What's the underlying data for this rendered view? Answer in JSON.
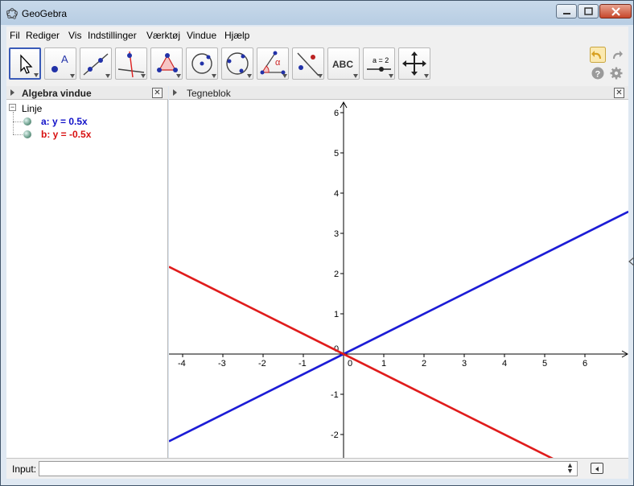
{
  "window": {
    "title": "GeoGebra"
  },
  "menu": [
    "Fil",
    "Rediger",
    "Vis",
    "Indstillinger",
    "Værktøj",
    "Vindue",
    "Hjælp"
  ],
  "toolbar": {
    "tools": [
      {
        "name": "move-tool",
        "icon": "arrow-pointer-icon",
        "active": true
      },
      {
        "name": "point-tool",
        "icon": "point-icon",
        "label": "A"
      },
      {
        "name": "line-tool",
        "icon": "line-through-points-icon"
      },
      {
        "name": "perpendicular-line-tool",
        "icon": "perpendicular-line-icon"
      },
      {
        "name": "polygon-tool",
        "icon": "polygon-icon"
      },
      {
        "name": "circle-tool",
        "icon": "circle-center-point-icon"
      },
      {
        "name": "conic-tool",
        "icon": "ellipse-icon"
      },
      {
        "name": "angle-tool",
        "icon": "angle-icon",
        "label": "α"
      },
      {
        "name": "reflect-tool",
        "icon": "reflect-about-line-icon"
      },
      {
        "name": "text-tool",
        "icon": "text-icon",
        "label": "ABC"
      },
      {
        "name": "slider-tool",
        "icon": "slider-icon",
        "label": "a = 2"
      },
      {
        "name": "move-graphics-tool",
        "icon": "move-graphics-icon"
      }
    ],
    "undo_icon": "undo-icon",
    "redo_icon": "redo-icon",
    "help_icon": "help-icon",
    "settings_icon": "gear-icon"
  },
  "algebra": {
    "title": "Algebra vindue",
    "group": "Linje",
    "items": [
      {
        "text": "a: y = 0.5x",
        "color": "#1010c8"
      },
      {
        "text": "b: y = -0.5x",
        "color": "#d81010"
      }
    ]
  },
  "graphics": {
    "title": "Tegneblok",
    "x_ticks": [
      "-4",
      "-3",
      "-2",
      "-1",
      "1",
      "2",
      "3",
      "4",
      "5",
      "6"
    ],
    "y_ticks": [
      "-2",
      "-1",
      "1",
      "2",
      "3",
      "4",
      "5",
      "6"
    ],
    "origin_label_x": "0",
    "origin_label_y": "0",
    "lines": [
      {
        "name": "a",
        "slope": 0.5,
        "color": "#1c1cd6"
      },
      {
        "name": "b",
        "slope": -0.5,
        "color": "#e01c1c"
      }
    ]
  },
  "input": {
    "label": "Input:",
    "value": ""
  }
}
